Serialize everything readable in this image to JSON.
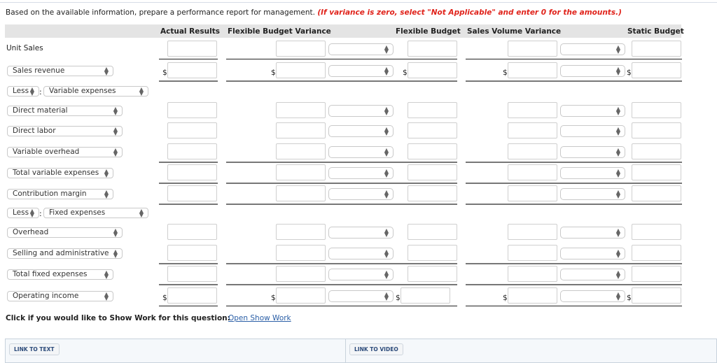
{
  "instructions": {
    "text": "Based on the available information, prepare a performance report for management.",
    "note": "(If variance is zero, select \"Not Applicable\" and enter 0 for the amounts.)"
  },
  "table": {
    "headers": {
      "actual_results": "Actual Results",
      "flexible_budget_variance": "Flexible Budget Variance",
      "flexible_budget": "Flexible Budget",
      "sales_volume_variance": "Sales Volume Variance",
      "static_budget": "Static Budget"
    },
    "currency_symbol": "$",
    "rows": [
      {
        "label": "Unit Sales",
        "type": "static"
      },
      {
        "label": "Sales revenue",
        "type": "select"
      },
      {
        "prefix": "Less",
        "label": "Variable expenses",
        "type": "less"
      },
      {
        "label": "Direct material",
        "type": "select"
      },
      {
        "label": "Direct labor",
        "type": "select"
      },
      {
        "label": "Variable overhead",
        "type": "select"
      },
      {
        "label": "Total variable expenses",
        "type": "select"
      },
      {
        "label": "Contribution margin",
        "type": "select"
      },
      {
        "prefix": "Less",
        "label": "Fixed expenses",
        "type": "less"
      },
      {
        "label": "Overhead",
        "type": "select"
      },
      {
        "label": "Selling and administrative",
        "type": "select"
      },
      {
        "label": "Total fixed expenses",
        "type": "select"
      },
      {
        "label": "Operating income",
        "type": "select"
      }
    ],
    "input_values": {
      "actual_results": "",
      "flexible_budget_variance": "",
      "flexible_budget_variance_type": "",
      "flexible_budget": "",
      "sales_volume_variance": "",
      "sales_volume_variance_type": "",
      "static_budget": ""
    }
  },
  "show_work": {
    "prompt": "Click if you would like to Show Work for this question:",
    "link": "Open Show Work"
  },
  "footer": {
    "link_to_text": "LINK TO TEXT",
    "link_to_video": "LINK TO VIDEO"
  },
  "colors": {
    "note_red": "#e0231b",
    "link_blue": "#2a5ea6",
    "header_gray": "#e4e4e4"
  }
}
